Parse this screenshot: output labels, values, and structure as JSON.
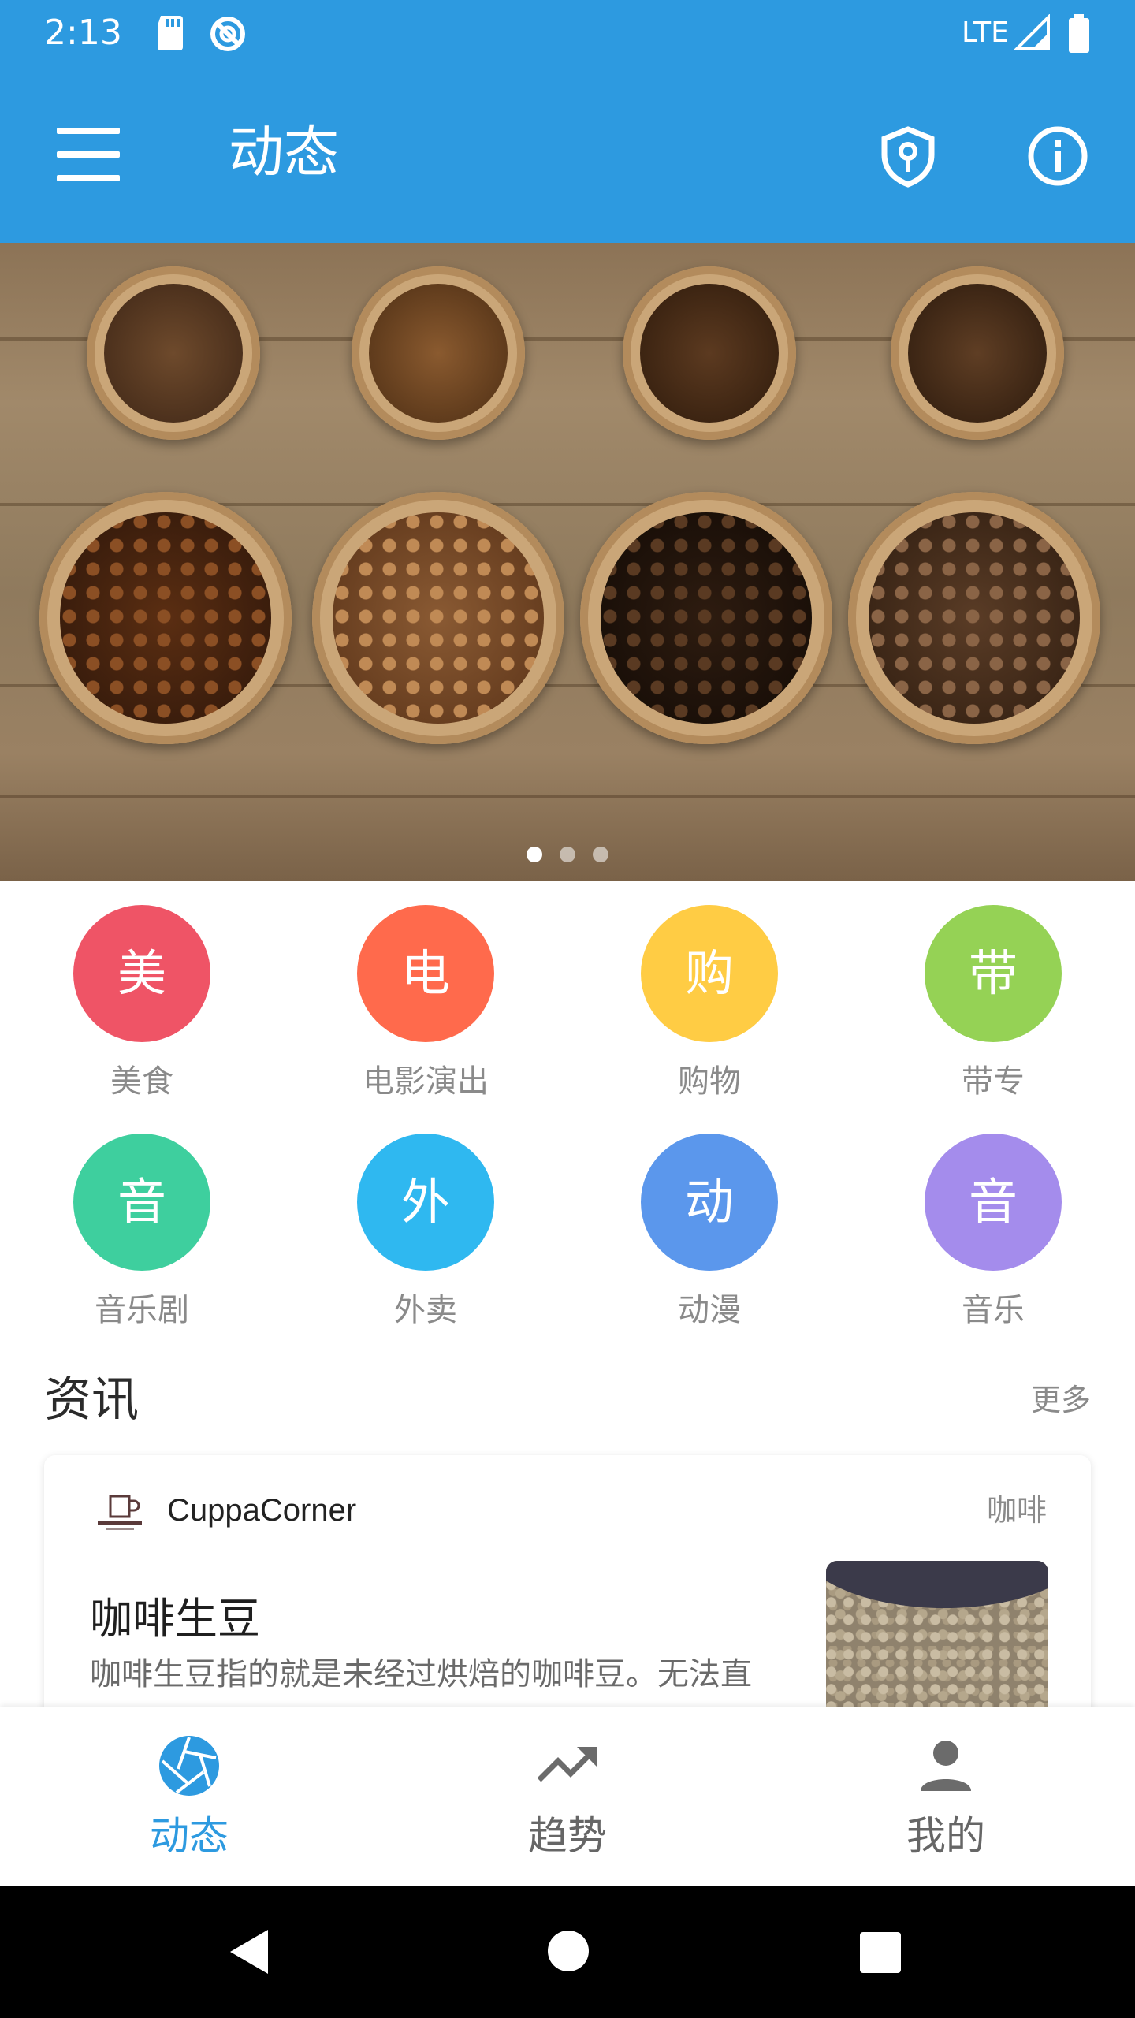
{
  "status_bar": {
    "time": "2:13",
    "network": "LTE",
    "icons": [
      "sd-card-icon",
      "sync-icon",
      "signal-icon",
      "battery-icon"
    ]
  },
  "app_bar": {
    "title": "动态",
    "icons": [
      "menu-icon",
      "shield-key-icon",
      "info-icon"
    ]
  },
  "banner": {
    "page_count": 3,
    "active_page": 1
  },
  "categories": [
    {
      "glyph": "美",
      "label": "美食",
      "color": "#ef5466"
    },
    {
      "glyph": "电",
      "label": "电影演出",
      "color": "#ff6a4c"
    },
    {
      "glyph": "购",
      "label": "购物",
      "color": "#ffcc44"
    },
    {
      "glyph": "带",
      "label": "带专",
      "color": "#95d255"
    },
    {
      "glyph": "音",
      "label": "音乐剧",
      "color": "#3ecf9e"
    },
    {
      "glyph": "外",
      "label": "外卖",
      "color": "#2fb8f0"
    },
    {
      "glyph": "动",
      "label": "动漫",
      "color": "#5b97ec"
    },
    {
      "glyph": "音",
      "label": "音乐",
      "color": "#a48cec"
    }
  ],
  "news": {
    "title": "资讯",
    "more": "更多",
    "card": {
      "brand": "CuppaCorner",
      "tag": "咖啡",
      "headline": "咖啡生豆",
      "summary": "咖啡生豆指的就是未经过烘焙的咖啡豆。无法直"
    }
  },
  "bottom_nav": {
    "items": [
      {
        "label": "动态",
        "icon": "aperture-icon",
        "active": true
      },
      {
        "label": "趋势",
        "icon": "trending-up-icon",
        "active": false
      },
      {
        "label": "我的",
        "icon": "person-icon",
        "active": false
      }
    ]
  },
  "colors": {
    "primary": "#2d9ae0",
    "inactive": "#666666"
  }
}
